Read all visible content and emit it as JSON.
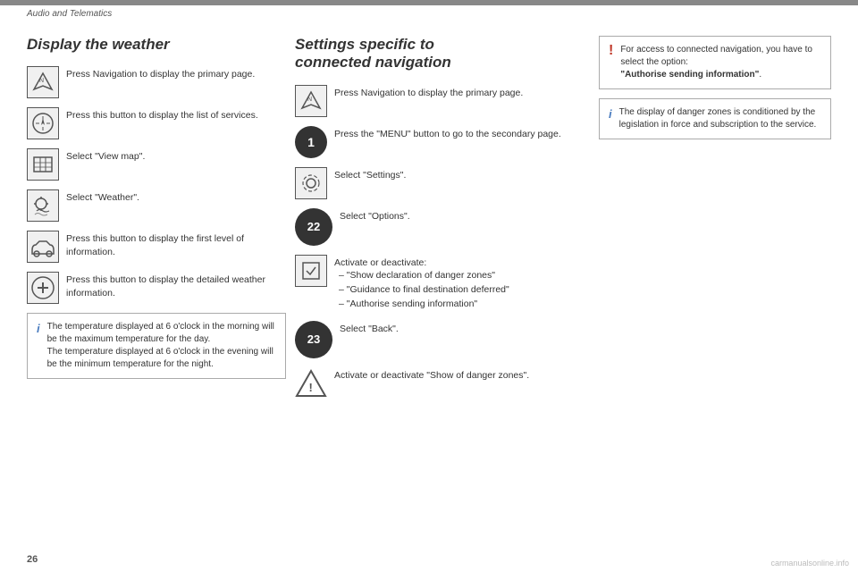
{
  "header": {
    "title": "Audio and Telematics",
    "topbar_color": "#888"
  },
  "page_number": "26",
  "left_section": {
    "title": "Display the weather",
    "steps": [
      {
        "icon_type": "nav",
        "text": "Press Navigation to display the primary page."
      },
      {
        "icon_type": "list",
        "text": "Press this button to display the list of services."
      },
      {
        "icon_type": "map",
        "text": "Select \"View map\"."
      },
      {
        "icon_type": "weather",
        "text": "Select \"Weather\"."
      },
      {
        "icon_type": "car",
        "text": "Press this button to display the first level of information."
      },
      {
        "icon_type": "plus",
        "text": "Press this button to display the detailed weather information."
      }
    ],
    "info_note": {
      "text": "The temperature displayed at 6 o'clock in the morning will be the maximum temperature for the day.\nThe temperature displayed at 6 o'clock in the evening will be the minimum temperature for the night."
    }
  },
  "middle_section": {
    "title_line1": "Settings specific to",
    "title_line2": "connected navigation",
    "steps": [
      {
        "icon_type": "nav",
        "text": "Press Navigation to display the primary page."
      },
      {
        "icon_type": "circle_num",
        "num": "1",
        "text": "Press the \"MENU\" button to go to the secondary page."
      },
      {
        "icon_type": "gear",
        "text": "Select \"Settings\"."
      },
      {
        "icon_type": "circle_num_large",
        "num": "22",
        "text": "Select \"Options\"."
      },
      {
        "icon_type": "checkbox",
        "text": "Activate or deactivate:",
        "bullets": [
          "\"Show declaration of danger zones\"",
          "\"Guidance to final destination deferred\"",
          "\"Authorise sending information\""
        ]
      },
      {
        "icon_type": "circle_num_large",
        "num": "23",
        "text": "Select \"Back\"."
      },
      {
        "icon_type": "triangle",
        "text": "Activate or deactivate \"Show of danger zones\"."
      }
    ]
  },
  "right_section": {
    "warning_box": {
      "icon": "!",
      "text": "For access to connected navigation, you have to select the option: \"Authorise sending information\"."
    },
    "info_box": {
      "icon": "i",
      "text": "The display of danger zones is conditioned by the legislation in force and subscription to the service."
    }
  }
}
